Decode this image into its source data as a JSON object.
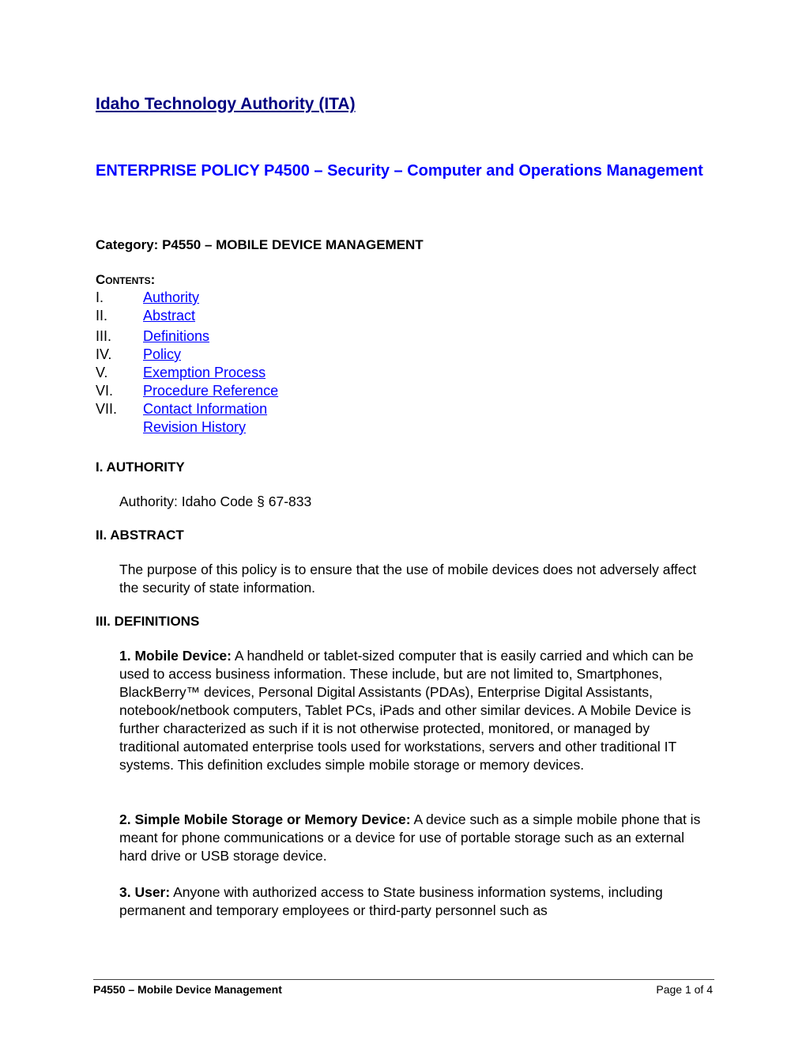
{
  "header": {
    "org_title": "Idaho Technology Authority (ITA)",
    "policy_title": "ENTERPRISE POLICY P4500 – Security – Computer and Operations Management",
    "category": "Category: P4550 – MOBILE DEVICE MANAGEMENT"
  },
  "contents": {
    "label": "Contents:",
    "items": [
      {
        "num": "I.",
        "label": "Authority"
      },
      {
        "num": "II.",
        "label": "Abstract"
      },
      {
        "num": "III.",
        "label": "Definitions"
      },
      {
        "num": "IV.",
        "label": "Policy"
      },
      {
        "num": "V.",
        "label": "Exemption Process"
      },
      {
        "num": "VI.",
        "label": "Procedure Reference"
      },
      {
        "num": "VII.",
        "label": "Contact Information"
      },
      {
        "num": "",
        "label": "Revision History"
      }
    ]
  },
  "sections": {
    "authority": {
      "heading": "I.  AUTHORITY",
      "text": "Authority: Idaho Code § 67-833"
    },
    "abstract": {
      "heading": "II.  ABSTRACT",
      "text": "The purpose of this policy is to ensure that the use of mobile devices does not adversely affect the security of state information."
    },
    "definitions": {
      "heading": "III.  DEFINITIONS",
      "items": [
        {
          "term": "1.  Mobile Device:",
          "text": "  A handheld or tablet-sized computer that is easily carried and which can be used to access business information.  These include, but are not limited to, Smartphones, BlackBerry™ devices, Personal Digital Assistants (PDAs), Enterprise Digital Assistants, notebook/netbook computers, Tablet PCs, iPads and other similar devices. A Mobile Device is further characterized as such if it is not otherwise protected, monitored, or managed by traditional automated enterprise tools used for workstations, servers and other traditional IT systems. This definition excludes simple mobile storage or memory devices."
        },
        {
          "term": "2.  Simple Mobile Storage or Memory Device:",
          "text": "  A device such as a simple mobile phone that is meant for phone communications or a device for use of portable storage such as an external hard drive or USB storage device."
        },
        {
          "term": "3.  User:",
          "text": "  Anyone with authorized access to State business information systems, including permanent and temporary employees or third-party personnel such as"
        }
      ]
    }
  },
  "footer": {
    "left": "P4550 – Mobile Device Management",
    "right": "Page 1 of 4"
  }
}
